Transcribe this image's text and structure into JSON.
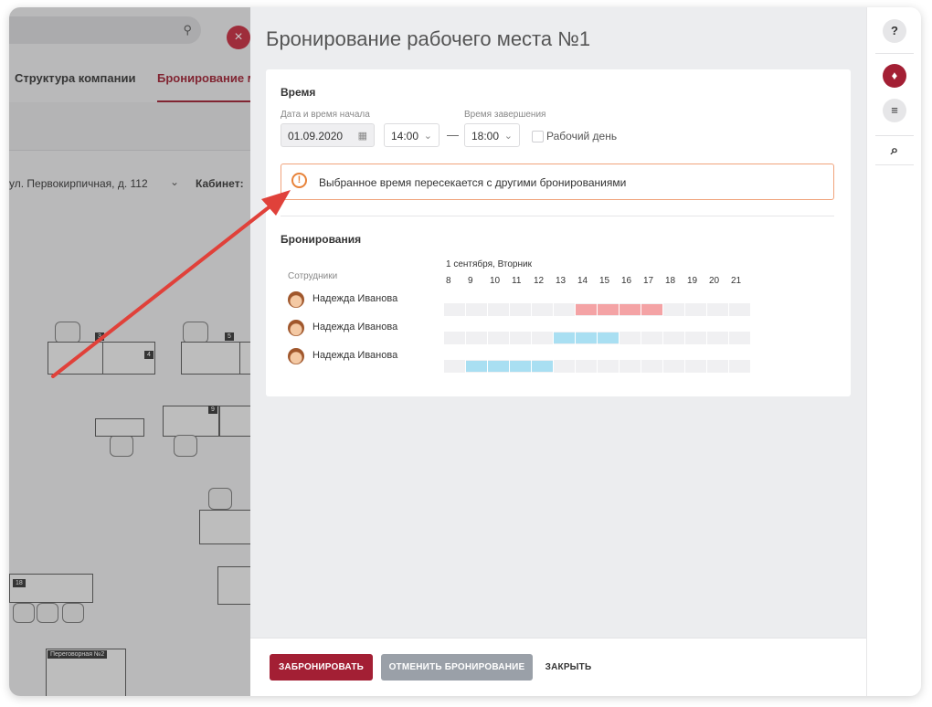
{
  "background": {
    "nav": {
      "item1": "Структура компании",
      "item2": "Бронирование м"
    },
    "filter": {
      "address": "ул. Первокирпичная, д. 112",
      "cabinet_label": "Кабинет:"
    },
    "map": {
      "desk_numbers": [
        "3",
        "4",
        "5",
        "9",
        "18"
      ],
      "room_label": "Переговорная №2"
    }
  },
  "modal": {
    "title": "Бронирование рабочего места №1",
    "time_section": {
      "title": "Время",
      "start_label": "Дата и время начала",
      "end_label": "Время завершения",
      "date_value": "01.09.2020",
      "start_time": "14:00",
      "end_time": "18:00",
      "dash": "—",
      "workday_label": "Рабочий день"
    },
    "alert": {
      "icon": "!",
      "text": "Выбранное время пересекается с другими бронированиями"
    },
    "bookings": {
      "title": "Бронирования",
      "employees_header": "Сотрудники",
      "date_header": "1 сентября, Вторник",
      "hours": [
        "8",
        "9",
        "10",
        "11",
        "12",
        "13",
        "14",
        "15",
        "16",
        "17",
        "18",
        "19",
        "20",
        "21"
      ],
      "rows": [
        {
          "name": "Надежда Иванова",
          "start": 14,
          "end": 18,
          "color": "#f4a3a5"
        },
        {
          "name": "Надежда Иванова",
          "start": 13,
          "end": 16,
          "color": "#a9dff2"
        },
        {
          "name": "Надежда Иванова",
          "start": 9,
          "end": 13,
          "color": "#a9dff2"
        }
      ]
    },
    "footer": {
      "book_label": "ЗАБРОНИРОВАТЬ",
      "cancel_label": "ОТМЕНИТЬ БРОНИРОВАНИЕ",
      "close_label": "ЗАКРЫТЬ"
    }
  },
  "rail": {
    "help": "?",
    "bell": "♦",
    "chat": "≡",
    "search": "⌕"
  },
  "colors": {
    "accent": "#a31f34",
    "warning": "#e8833a",
    "alert_border": "#f0a37c",
    "secondary_button": "#9aa0a8"
  }
}
